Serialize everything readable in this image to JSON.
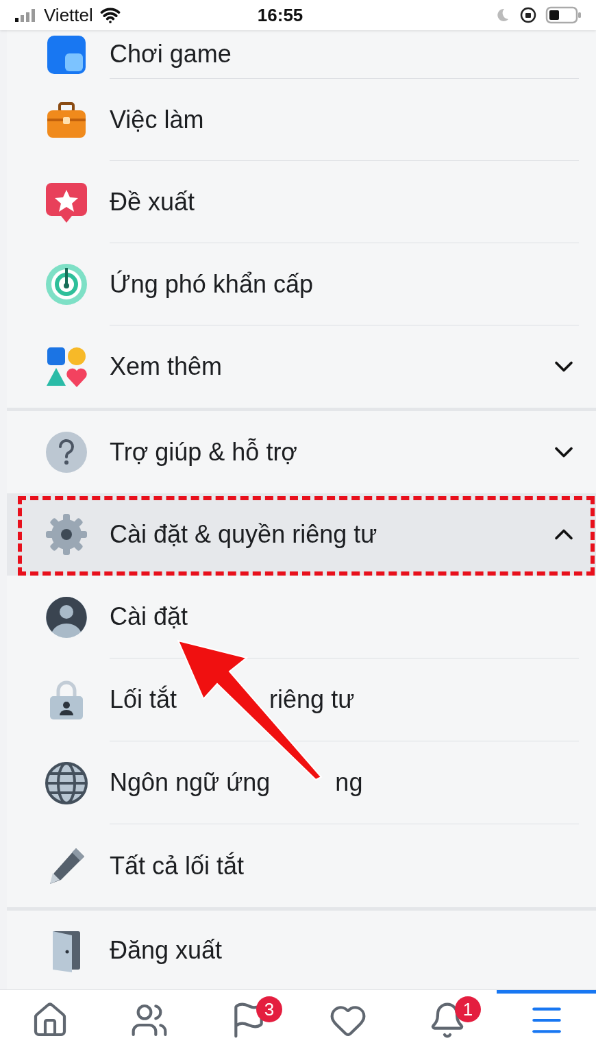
{
  "status_bar": {
    "carrier": "Viettel",
    "time": "16:55"
  },
  "shortcuts": [
    {
      "label": "Chơi game"
    },
    {
      "label": "Việc làm"
    },
    {
      "label": "Đề xuất"
    },
    {
      "label": "Ứng phó khẩn cấp"
    },
    {
      "label": "Xem thêm",
      "expanded": false
    }
  ],
  "sections": [
    {
      "label": "Trợ giúp & hỗ trợ",
      "expanded": false,
      "highlighted": false
    },
    {
      "label": "Cài đặt & quyền riêng tư",
      "expanded": true,
      "highlighted": true,
      "children": [
        {
          "label": "Cài đặt"
        },
        {
          "label_parts": [
            "Lối tắt",
            "riêng tư"
          ]
        },
        {
          "label_parts": [
            "Ngôn ngữ ứng",
            "ng"
          ]
        },
        {
          "label": "Tất cả lối tắt"
        }
      ]
    }
  ],
  "logout": {
    "label": "Đăng xuất"
  },
  "bottom_nav": [
    {
      "selected": false
    },
    {
      "selected": false
    },
    {
      "selected": false,
      "badge": "3"
    },
    {
      "selected": false
    },
    {
      "selected": false,
      "badge": "1"
    },
    {
      "selected": true
    }
  ]
}
